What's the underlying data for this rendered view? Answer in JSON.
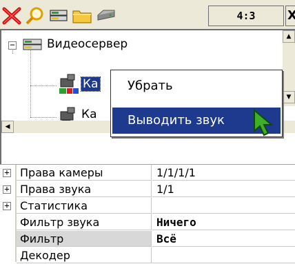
{
  "toolbar": {
    "buttons": [
      {
        "name": "delete-button",
        "icon": "red-x-icon"
      },
      {
        "name": "search-button",
        "icon": "magnifier-icon"
      },
      {
        "name": "device-button",
        "icon": "device-icon"
      },
      {
        "name": "folder-button",
        "icon": "folder-icon"
      },
      {
        "name": "drive-button",
        "icon": "drive-icon"
      }
    ],
    "aspect_ratio": "4:3",
    "right_glyph": "X"
  },
  "tree": {
    "root": {
      "label": "Видеосервер",
      "expander": "−",
      "icon": "video-server-icon"
    },
    "children": [
      {
        "label": "Ка",
        "icon": "camera-icon",
        "selected": true
      },
      {
        "label": "Ка",
        "icon": "camera-icon",
        "selected": false
      }
    ]
  },
  "context_menu": {
    "items": [
      {
        "label": "Убрать",
        "selected": false
      },
      {
        "label": "Выводить звук",
        "selected": true
      }
    ]
  },
  "properties": {
    "rows": [
      {
        "expander": "+",
        "name": "Права камеры",
        "value": "1/1/1/1",
        "bold": false
      },
      {
        "expander": "+",
        "name": "Права звука",
        "value": "1/1",
        "bold": false
      },
      {
        "expander": "+",
        "name": "Статистика",
        "value": "",
        "bold": false
      },
      {
        "expander": "",
        "name": "Фильтр звука",
        "value": "Ничего",
        "bold": true
      },
      {
        "expander": "",
        "name": "Фильтр",
        "value": "Всё",
        "bold": true
      },
      {
        "expander": "",
        "name": "Декодер",
        "value": "",
        "bold": false
      }
    ]
  },
  "colors": {
    "toolbar_bg": "#ece9d8",
    "selection": "#1e3a8f",
    "cursor": "#3fae2a"
  }
}
